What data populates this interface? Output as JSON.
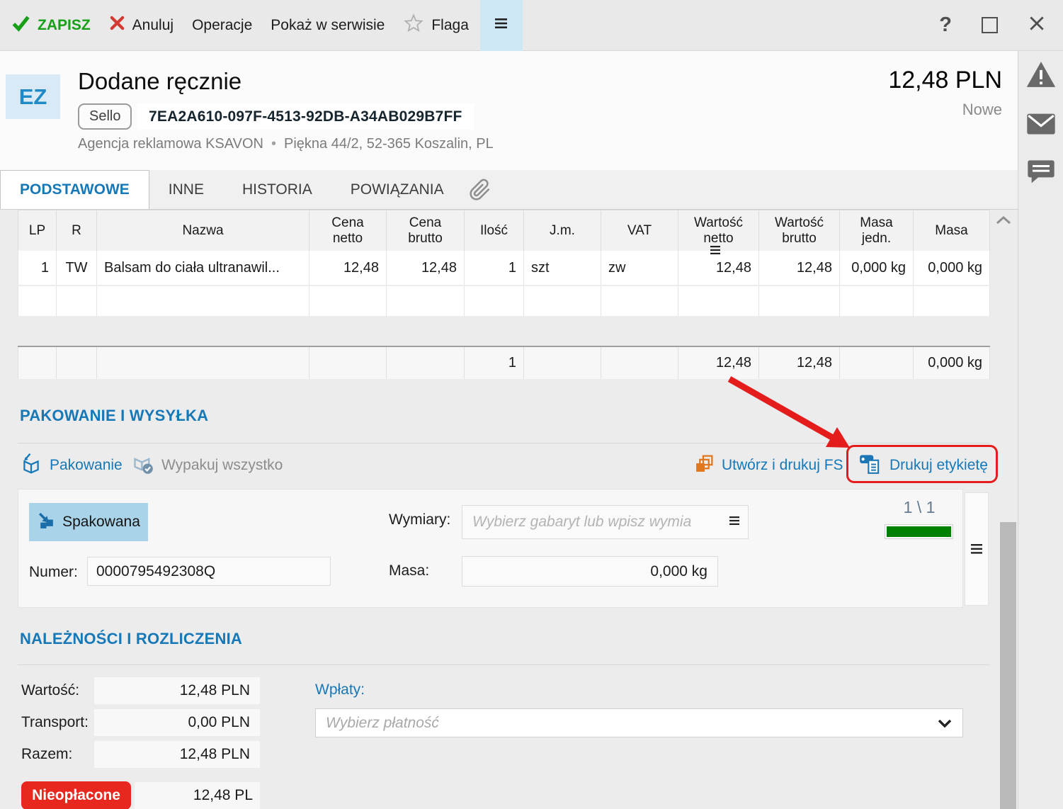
{
  "toolbar": {
    "save": "ZAPISZ",
    "cancel": "Anuluj",
    "operations": "Operacje",
    "show_in_service": "Pokaż w serwisie",
    "flag": "Flaga",
    "help": "?"
  },
  "header": {
    "doc_type": "EZ",
    "title": "Dodane ręcznie",
    "source_badge": "Sello",
    "guid": "7EA2A610-097F-4513-92DB-A34AB029B7FF",
    "company": "Agencja reklamowa KSAVON",
    "separator": "•",
    "address": "Piękna 44/2, 52-365 Koszalin, PL",
    "amount": "12,48 PLN",
    "status": "Nowe"
  },
  "tabs": [
    {
      "label": "PODSTAWOWE",
      "active": true
    },
    {
      "label": "INNE",
      "active": false
    },
    {
      "label": "HISTORIA",
      "active": false
    },
    {
      "label": "POWIĄZANIA",
      "active": false
    }
  ],
  "items_table": {
    "columns": [
      "LP",
      "R",
      "Nazwa",
      "Cena netto",
      "Cena brutto",
      "Ilość",
      "J.m.",
      "VAT",
      "Wartość netto",
      "Wartość brutto",
      "Masa jedn.",
      "Masa"
    ],
    "rows": [
      [
        "1",
        "TW",
        "Balsam do ciała ultranawil...",
        "12,48",
        "12,48",
        "1",
        "szt",
        "zw",
        "12,48",
        "12,48",
        "0,000 kg",
        "0,000 kg"
      ]
    ],
    "summary": [
      "",
      "",
      "",
      "",
      "",
      "1",
      "",
      "",
      "12,48",
      "12,48",
      "",
      "0,000 kg"
    ]
  },
  "packing": {
    "section_title": "PAKOWANIE I WYSYŁKA",
    "pack_link": "Pakowanie",
    "unpack_link": "Wypakuj wszystko",
    "create_print_fs_link": "Utwórz i drukuj FS",
    "print_label_link": "Drukuj etykietę",
    "packed_button": "Spakowana",
    "number_label": "Numer:",
    "number_value": "0000795492308Q",
    "dimensions_label": "Wymiary:",
    "dimensions_placeholder": "Wybierz gabaryt lub wpisz wymia",
    "weight_label": "Masa:",
    "weight_value": "0,000 kg",
    "page_indicator": "1 \\ 1",
    "progress_percent": 100
  },
  "payments": {
    "section_title": "NALEŻNOŚCI I ROZLICZENIA",
    "value_label": "Wartość:",
    "value": "12,48 PLN",
    "transport_label": "Transport:",
    "transport": "0,00 PLN",
    "total_label": "Razem:",
    "total": "12,48 PLN",
    "unpaid_badge": "Nieopłacone",
    "unpaid_value": "12,48 PL",
    "payments_label": "Wpłaty:",
    "payments_placeholder": "Wybierz płatność"
  },
  "colors": {
    "accent_blue": "#1778b8",
    "save_green": "#17a017",
    "cancel_red": "#d23b31",
    "annotation_red": "#e41c1c",
    "badge_red": "#e8281e",
    "progress_green": "#008000",
    "packed_button_bg": "#a9d3e8",
    "menu_highlight": "#cde7f5"
  },
  "icons": {
    "check": "check-icon",
    "cancel": "x-icon",
    "flag": "star-icon",
    "menu": "hamburger-icon",
    "attachment": "paperclip-icon",
    "warning": "warning-triangle-icon",
    "mail": "envelope-icon",
    "chat": "speech-bubble-icon",
    "pack": "box-arrow-icon",
    "unpack": "box-check-icon",
    "fs": "stacked-pages-icon",
    "label": "tag-document-icon",
    "lines": "options-lines-icon",
    "chevron_down": "chevron-down-icon",
    "chevron_up": "chevron-up-icon"
  }
}
